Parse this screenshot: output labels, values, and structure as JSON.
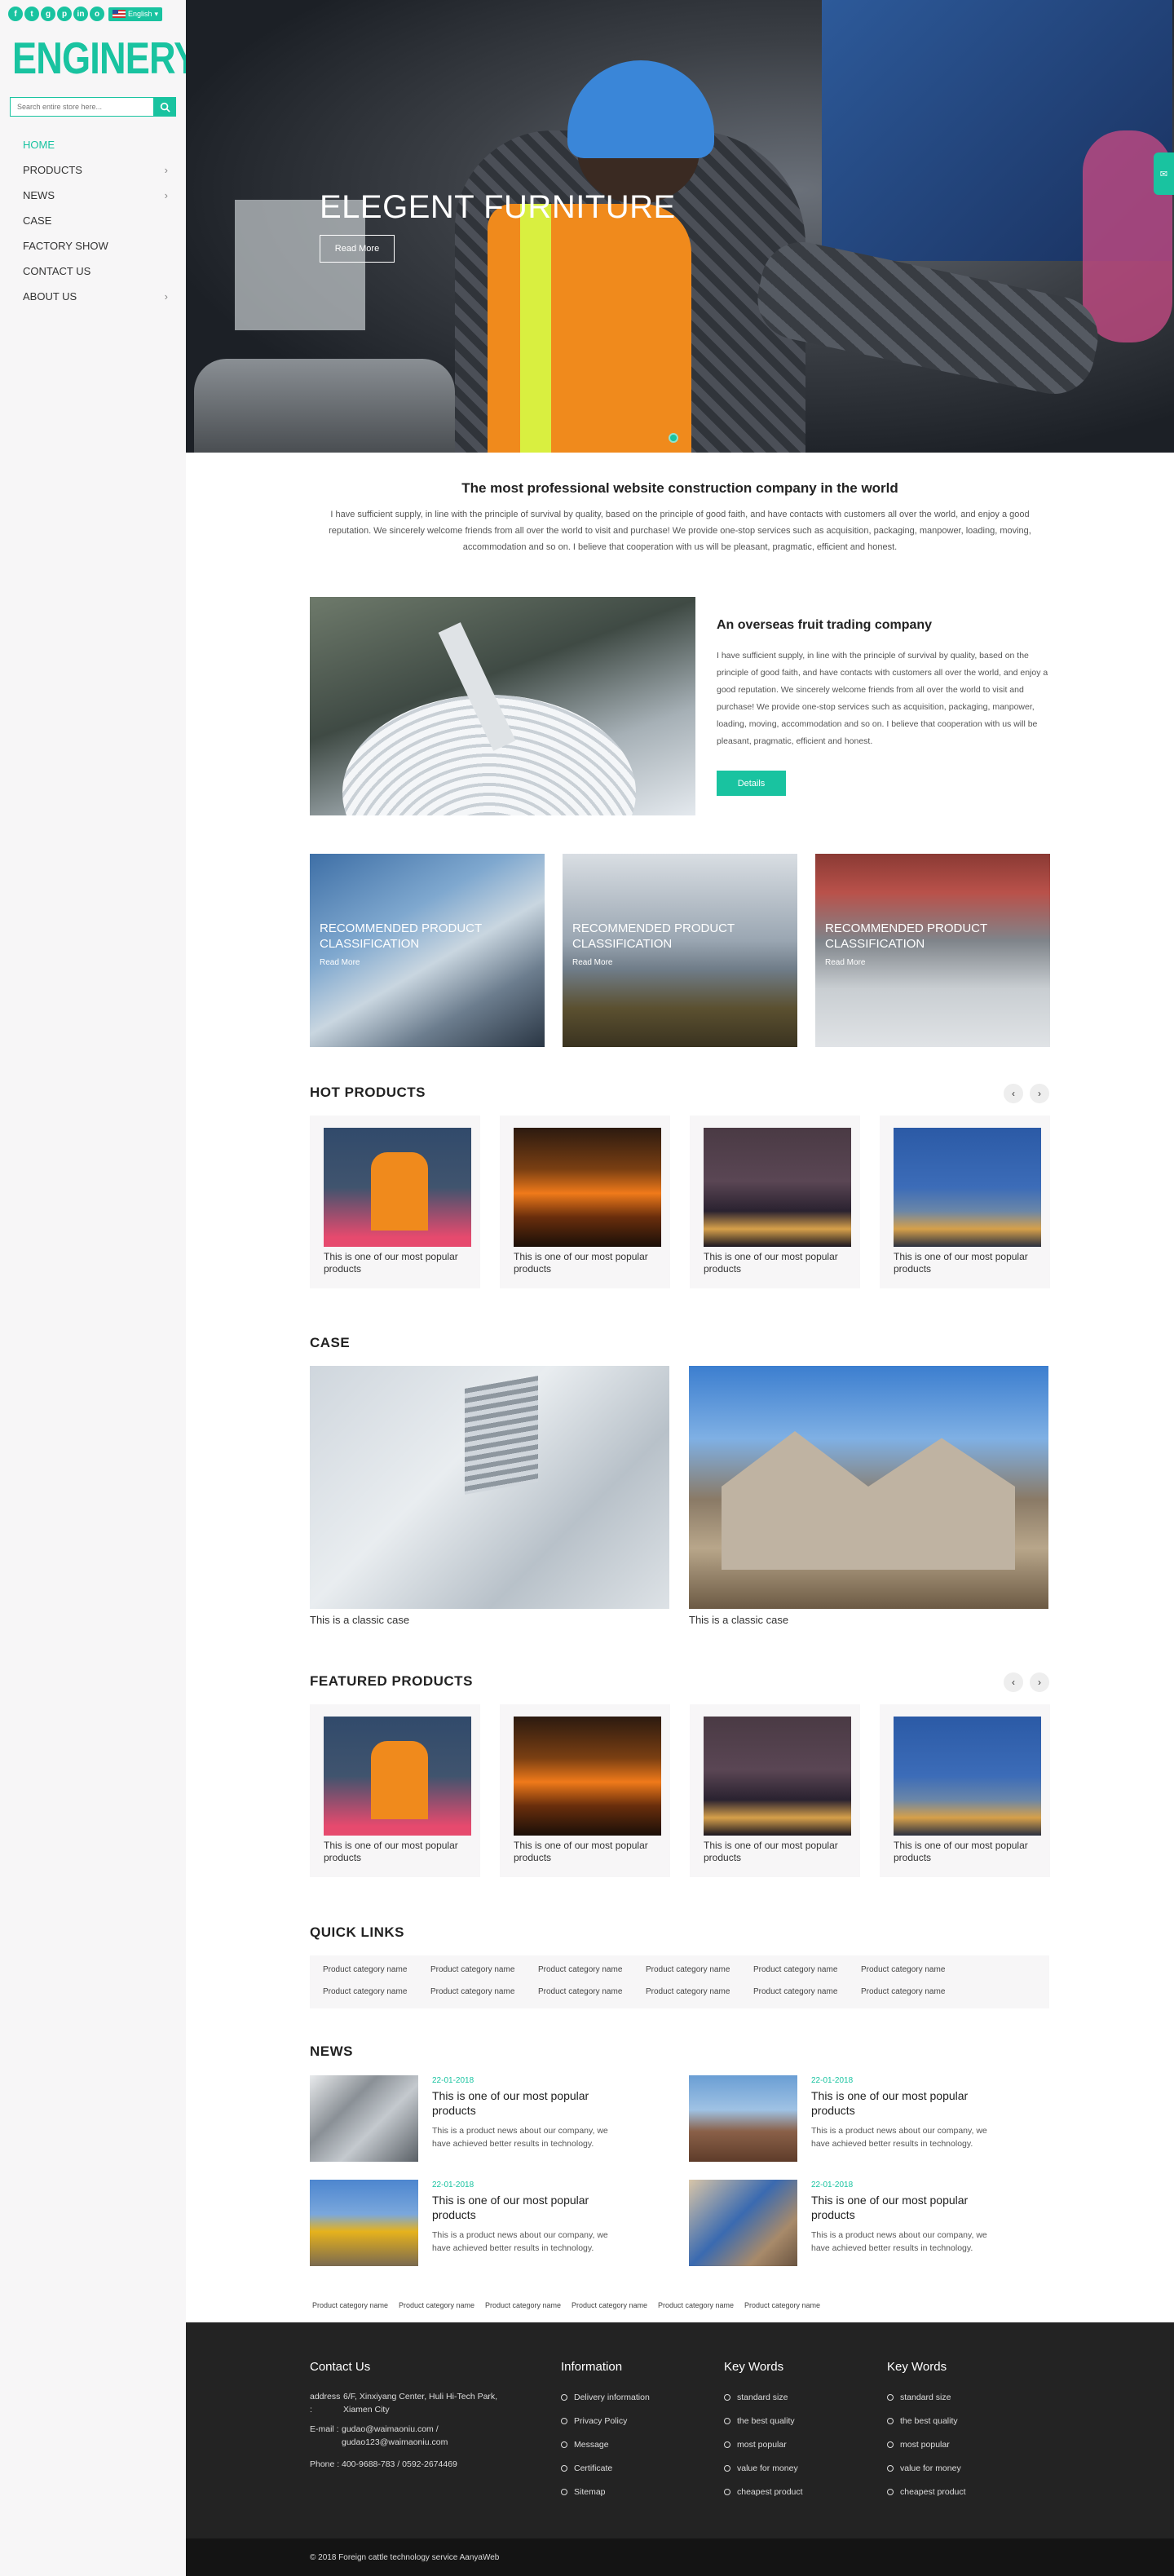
{
  "sidebar": {
    "social": [
      "f",
      "t",
      "g",
      "p",
      "in",
      "o"
    ],
    "language": "English",
    "logo": "ENGINERY",
    "search_placeholder": "Search entire store here...",
    "nav": [
      {
        "label": "HOME",
        "has_submenu": false
      },
      {
        "label": "PRODUCTS",
        "has_submenu": true
      },
      {
        "label": "NEWS",
        "has_submenu": true
      },
      {
        "label": "CASE",
        "has_submenu": false
      },
      {
        "label": "FACTORY SHOW",
        "has_submenu": false
      },
      {
        "label": "CONTACT US",
        "has_submenu": false
      },
      {
        "label": "ABOUT US",
        "has_submenu": true
      }
    ]
  },
  "hero": {
    "title": "ELEGENT FURNITURE",
    "button": "Read More"
  },
  "intro": {
    "title": "The most professional website construction company in the world",
    "text": "I have sufficient supply, in line with the principle of survival by quality, based on the principle of good faith, and have contacts with customers all over the world, and enjoy a good reputation. We sincerely welcome friends from all over the world to visit and purchase! We provide one-stop services such as acquisition, packaging, manpower, loading, moving, accommodation and so on. I believe that cooperation with us will be pleasant, pragmatic, efficient and honest."
  },
  "about": {
    "title": "An overseas fruit trading company",
    "text": "I have sufficient supply, in line with the principle of survival by quality, based on the principle of good faith, and have contacts with customers all over the world, and enjoy a good reputation. We sincerely welcome friends from all over the world to visit and purchase! We provide one-stop services such as acquisition, packaging, manpower, loading, moving, accommodation and so on. I believe that cooperation with us will be pleasant, pragmatic, efficient and honest.",
    "button": "Details"
  },
  "categories": [
    {
      "title": "RECOMMENDED PRODUCT CLASSIFICATION",
      "more": "Read More"
    },
    {
      "title": "RECOMMENDED PRODUCT CLASSIFICATION",
      "more": "Read More"
    },
    {
      "title": "RECOMMENDED PRODUCT CLASSIFICATION",
      "more": "Read More"
    }
  ],
  "hot_products": {
    "title": "HOT PRODUCTS",
    "items": [
      "This is one of our most popular products",
      "This is one of our most popular products",
      "This is one of our most popular products",
      "This is one of our most popular products"
    ]
  },
  "case": {
    "title": "CASE",
    "items": [
      "This is a classic case",
      "This is a classic case"
    ]
  },
  "featured_products": {
    "title": "FEATURED PRODUCTS",
    "items": [
      "This is one of our most popular products",
      "This is one of our most popular products",
      "This is one of our most popular products",
      "This is one of our most popular products"
    ]
  },
  "quick_links": {
    "title": "QUICK LINKS",
    "items": [
      "Product category name",
      "Product category name",
      "Product category name",
      "Product category name",
      "Product category name",
      "Product category name",
      "Product category name",
      "Product category name",
      "Product category name",
      "Product category name",
      "Product category name",
      "Product category name"
    ]
  },
  "news": {
    "title": "NEWS",
    "items": [
      {
        "date": "22-01-2018",
        "title": "This is one of our most popular products",
        "text": "This is a product news about our company, we have achieved better results in technology."
      },
      {
        "date": "22-01-2018",
        "title": "This is one of our most popular products",
        "text": "This is a product news about our company, we have achieved better results in technology."
      },
      {
        "date": "22-01-2018",
        "title": "This is one of our most popular products",
        "text": "This is a product news about our company, we have achieved better results in technology."
      },
      {
        "date": "22-01-2018",
        "title": "This is one of our most popular products",
        "text": "This is a product news about our company, we have achieved better results in technology."
      }
    ]
  },
  "footer_links": [
    "Product category name",
    "Product category name",
    "Product category name",
    "Product category name",
    "Product category name",
    "Product category name"
  ],
  "footer": {
    "contact": {
      "title": "Contact Us",
      "address_label": "address :",
      "address": "6/F, Xinxiyang Center, Huli Hi-Tech Park, Xiamen City",
      "email_label": "E-mail :",
      "email": "gudao@waimaoniu.com / gudao123@waimaoniu.com",
      "phone_label": "Phone :",
      "phone": "400-9688-783 / 0592-2674469"
    },
    "information": {
      "title": "Information",
      "items": [
        "Delivery information",
        "Privacy Policy",
        "Message",
        "Certificate",
        "Sitemap"
      ]
    },
    "keywords1": {
      "title": "Key Words",
      "items": [
        "standard size",
        "the best quality",
        "most popular",
        "value for money",
        "cheapest product"
      ]
    },
    "keywords2": {
      "title": "Key Words",
      "items": [
        "standard size",
        "the best quality",
        "most popular",
        "value for money",
        "cheapest product"
      ]
    },
    "copyright": "© 2018 Foreign cattle technology service AanyaWeb"
  },
  "colors": {
    "accent": "#19c3a0",
    "sidebar_bg": "#f7f6f7",
    "footer_bg": "#232323",
    "copyright_bg": "#141414"
  }
}
